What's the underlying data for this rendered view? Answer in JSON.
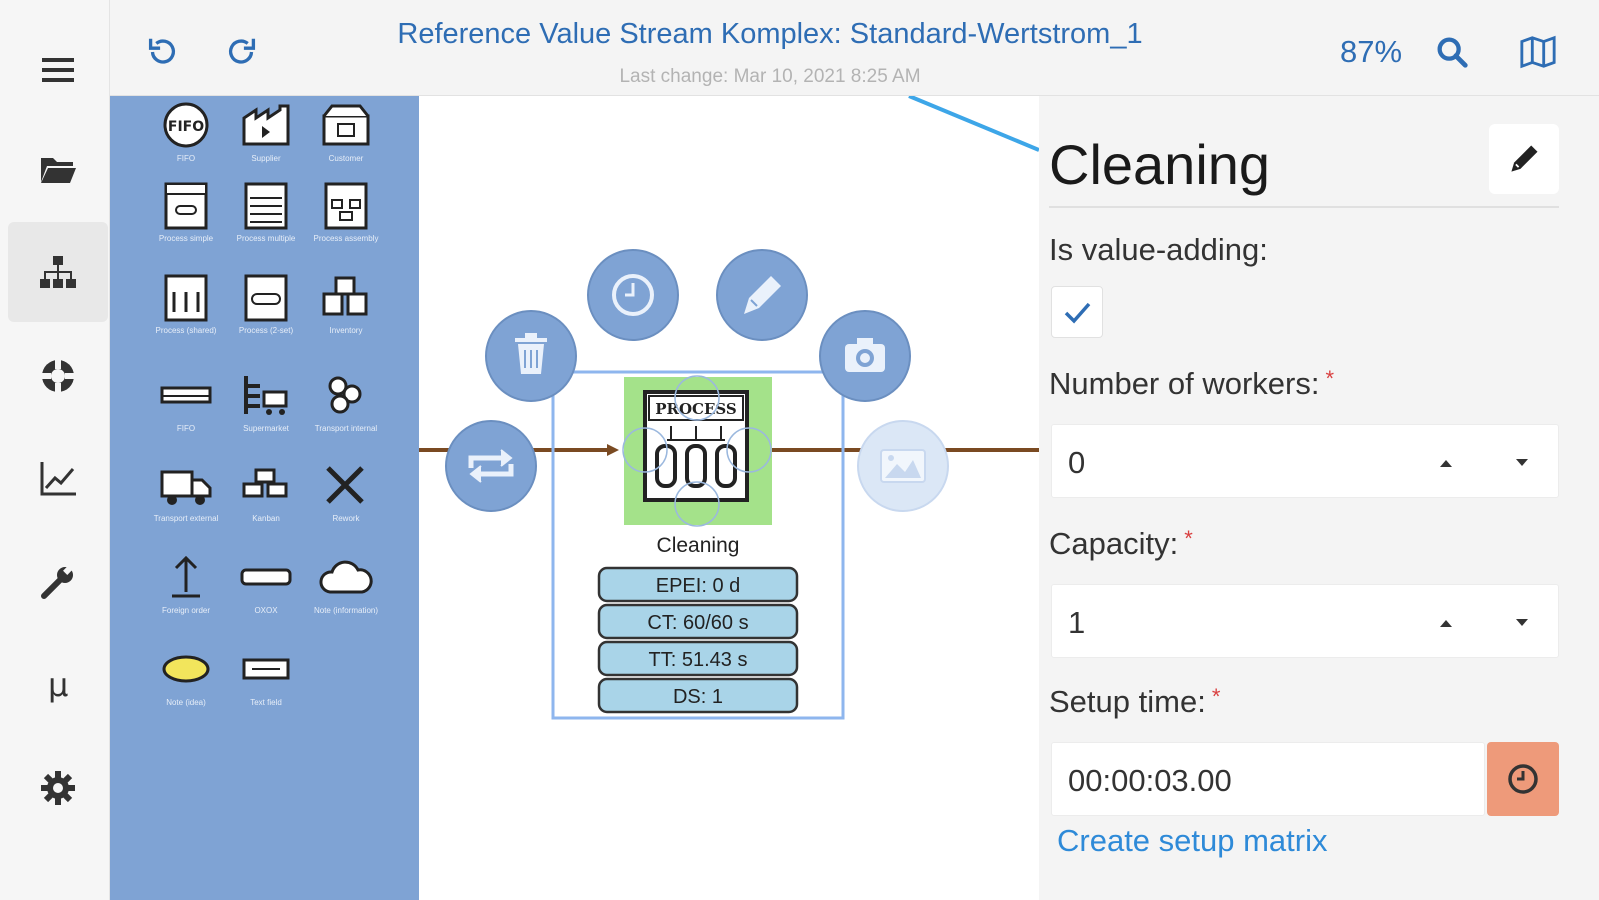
{
  "header": {
    "title": "Reference Value Stream Komplex: Standard-Wertstrom_1",
    "last_change": "Last change: Mar 10, 2021 8:25 AM",
    "zoom": "87%"
  },
  "palette": {
    "items": [
      {
        "icon": "fifo-icon",
        "label": "FIFO"
      },
      {
        "icon": "supplier-icon",
        "label": "Supplier"
      },
      {
        "icon": "customer-icon",
        "label": "Customer"
      },
      {
        "icon": "process-simple-icon",
        "label": "Process simple"
      },
      {
        "icon": "process-multiple-icon",
        "label": "Process multiple"
      },
      {
        "icon": "process-assembly-icon",
        "label": "Process assembly"
      },
      {
        "icon": "process-shared-icon",
        "label": "Process (shared)"
      },
      {
        "icon": "process-2-icon",
        "label": "Process (2-set)"
      },
      {
        "icon": "inventory-icon",
        "label": "Inventory"
      },
      {
        "icon": "fifo-lane-icon",
        "label": "FIFO"
      },
      {
        "icon": "supermarket-icon",
        "label": "Supermarket"
      },
      {
        "icon": "transport-internal-icon",
        "label": "Transport internal"
      },
      {
        "icon": "transport-external-icon",
        "label": "Transport external"
      },
      {
        "icon": "kanban-icon",
        "label": "Kanban"
      },
      {
        "icon": "rework-icon",
        "label": "Rework"
      },
      {
        "icon": "foreign-order-icon",
        "label": "Foreign order"
      },
      {
        "icon": "oxox-icon",
        "label": "OXOX"
      },
      {
        "icon": "cloud-icon",
        "label": "Note (information)"
      },
      {
        "icon": "kaizen-icon",
        "label": "Note (idea)"
      },
      {
        "icon": "text-icon",
        "label": "Text field"
      }
    ]
  },
  "canvas": {
    "node_name": "Cleaning",
    "node_header": "PROCESS",
    "metrics": [
      "EPEI: 0 d",
      "CT: 60/60 s",
      "TT: 51.43 s",
      "DS: 1"
    ]
  },
  "properties": {
    "title": "Cleaning",
    "value_adding_label": "Is value-adding:",
    "value_adding_checked": true,
    "workers_label": "Number of workers:",
    "workers_value": "0",
    "capacity_label": "Capacity:",
    "capacity_value": "1",
    "setup_label": "Setup time:",
    "setup_value": "00:00:03.00",
    "required_mark": "*",
    "setup_link": "Create setup matrix"
  },
  "colors": {
    "accent": "#2e6db4",
    "palette_bg": "#7fa3d4",
    "action_circle": "#7fa3d4",
    "selection_green": "#a4e28a",
    "metric_box": "#a9d4e8",
    "flow_line": "#7a4a22",
    "time_button": "#ee9a7a",
    "link": "#2e8ad8"
  }
}
